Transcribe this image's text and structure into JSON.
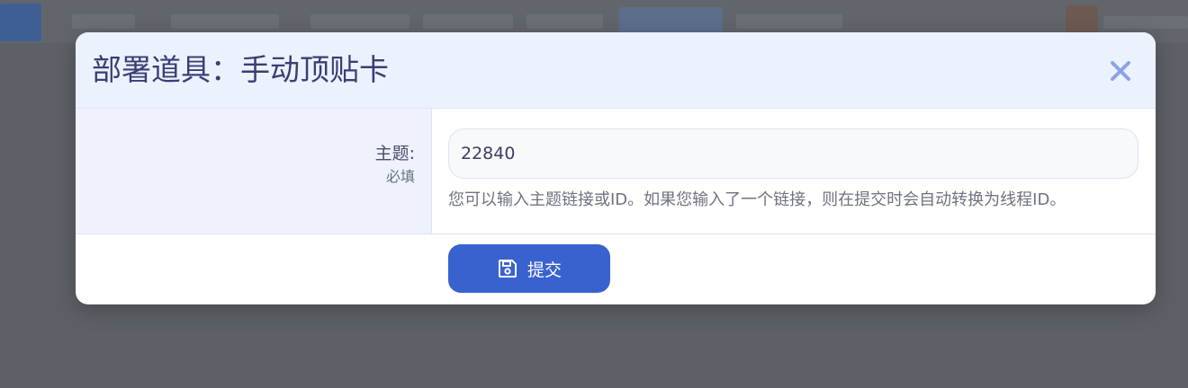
{
  "dialog": {
    "title": "部署道具：手动顶贴卡",
    "close_icon": "close-icon"
  },
  "form": {
    "topic_label": "主题:",
    "required_label": "必填",
    "topic_value": "22840",
    "help_text": "您可以输入主题链接或ID。如果您输入了一个链接，则在提交时会自动转换为线程ID。"
  },
  "submit": {
    "label": "提交",
    "icon": "save-icon"
  },
  "colors": {
    "accent": "#3a62cf",
    "header_bg": "#ebf2fe",
    "title_text": "#3b3e73",
    "close_icon": "#8aa2e6"
  }
}
